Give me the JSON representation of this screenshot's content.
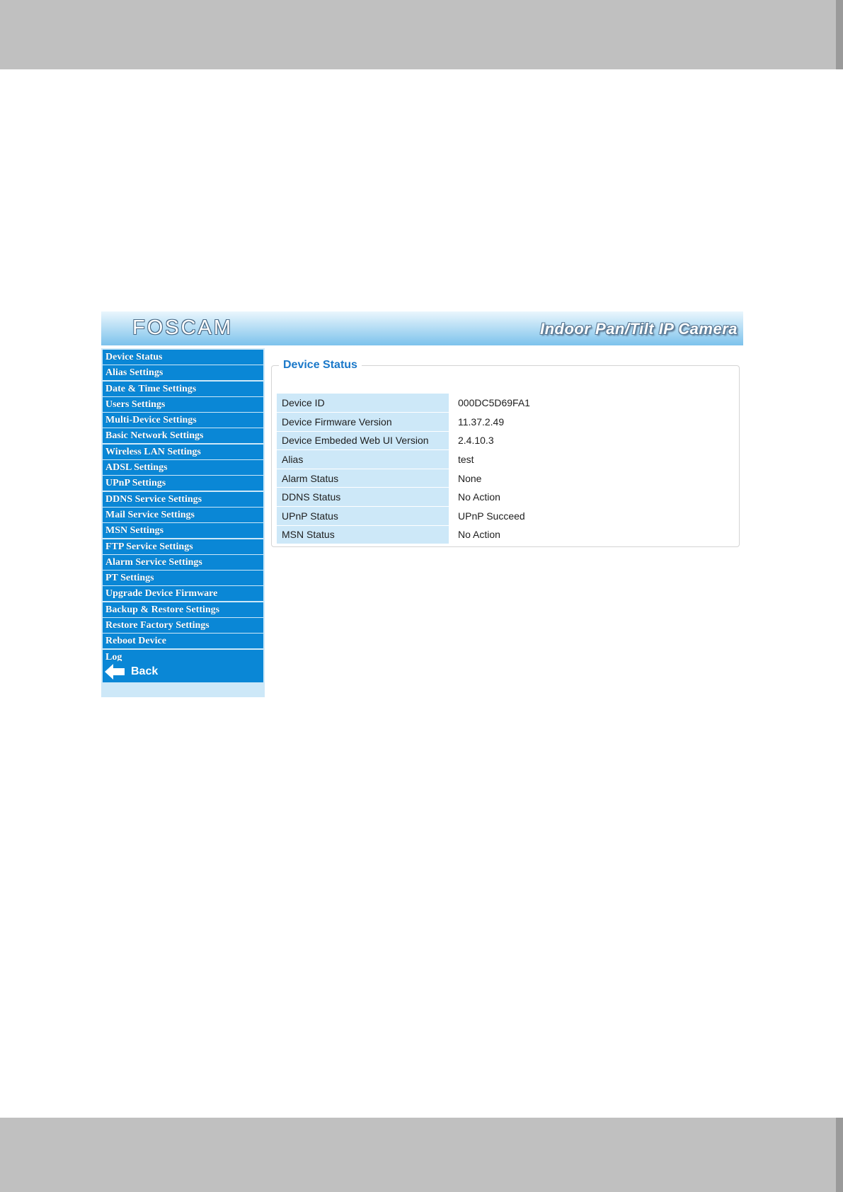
{
  "header": {
    "logo_text": "FOSCAM",
    "product_name": "Indoor Pan/Tilt IP Camera"
  },
  "sidebar": {
    "items": [
      {
        "label": "Device Status"
      },
      {
        "label": "Alias Settings"
      },
      {
        "label": "Date & Time Settings"
      },
      {
        "label": "Users Settings"
      },
      {
        "label": "Multi-Device Settings"
      },
      {
        "label": "Basic Network Settings"
      },
      {
        "label": "Wireless LAN Settings"
      },
      {
        "label": "ADSL Settings"
      },
      {
        "label": "UPnP Settings"
      },
      {
        "label": "DDNS Service Settings"
      },
      {
        "label": "Mail Service Settings"
      },
      {
        "label": "MSN Settings"
      },
      {
        "label": "FTP Service Settings"
      },
      {
        "label": "Alarm Service Settings"
      },
      {
        "label": "PT Settings"
      },
      {
        "label": "Upgrade Device Firmware"
      },
      {
        "label": "Backup & Restore Settings"
      },
      {
        "label": "Restore Factory Settings"
      },
      {
        "label": "Reboot Device"
      },
      {
        "label": "Log"
      }
    ],
    "back_label": "Back"
  },
  "panel": {
    "title": "Device Status",
    "rows": [
      {
        "label": "Device ID",
        "value": "000DC5D69FA1"
      },
      {
        "label": "Device Firmware Version",
        "value": "11.37.2.49"
      },
      {
        "label": "Device Embeded Web UI Version",
        "value": "2.4.10.3"
      },
      {
        "label": "Alias",
        "value": "test"
      },
      {
        "label": "Alarm Status",
        "value": "None"
      },
      {
        "label": "DDNS Status",
        "value": "No Action"
      },
      {
        "label": "UPnP Status",
        "value": "UPnP Succeed"
      },
      {
        "label": "MSN Status",
        "value": "No Action"
      }
    ]
  },
  "colors": {
    "menu_blue": "#0a87d6",
    "sidebar_bg": "#cde8f8",
    "title_blue": "#1a78c9",
    "page_band": "#c0c0c0"
  }
}
